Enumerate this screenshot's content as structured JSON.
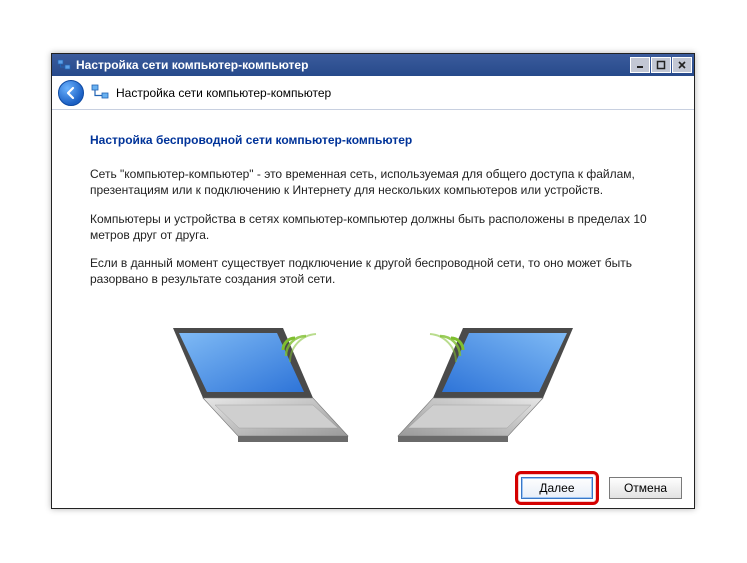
{
  "window": {
    "title": "Настройка сети компьютер-компьютер"
  },
  "header": {
    "title": "Настройка сети компьютер-компьютер"
  },
  "content": {
    "heading": "Настройка беспроводной сети компьютер-компьютер",
    "paragraph1": "Сеть \"компьютер-компьютер\" - это временная сеть, используемая для общего доступа к файлам, презентациям или к подключению к Интернету для нескольких компьютеров или устройств.",
    "paragraph2": "Компьютеры и устройства в сетях компьютер-компьютер должны быть расположены в пределах 10 метров друг от друга.",
    "paragraph3": "Если в данный момент существует подключение к другой беспроводной сети, то оно может быть разорвано в результате создания этой сети."
  },
  "footer": {
    "next_label": "Далее",
    "cancel_label": "Отмена"
  }
}
